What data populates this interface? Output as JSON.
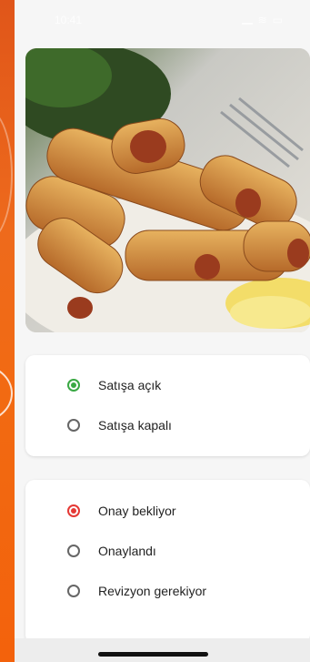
{
  "status_bar": {
    "time": "10:41"
  },
  "image": {
    "alt": "Sarma"
  },
  "sale_options": [
    {
      "label": "Satışa açık",
      "selected": true,
      "color": "#3aa844"
    },
    {
      "label": "Satışa kapalı",
      "selected": false
    }
  ],
  "approval_options": [
    {
      "label": "Onay bekliyor",
      "selected": true,
      "color": "#e53935"
    },
    {
      "label": "Onaylandı",
      "selected": false
    },
    {
      "label": "Revizyon gerekiyor",
      "selected": false
    }
  ]
}
